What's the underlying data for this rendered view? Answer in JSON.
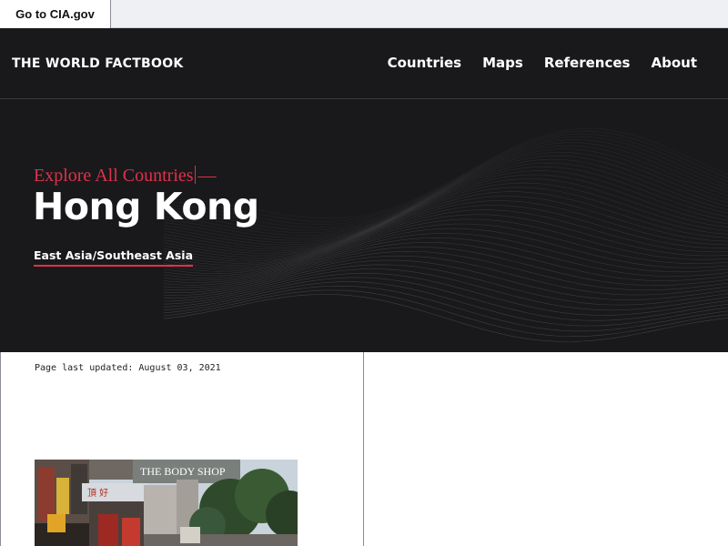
{
  "utility": {
    "cia_link": "Go to CIA.gov"
  },
  "header": {
    "brand": "THE WORLD FACTBOOK",
    "nav": [
      {
        "label": "Countries"
      },
      {
        "label": "Maps"
      },
      {
        "label": "References"
      },
      {
        "label": "About"
      }
    ]
  },
  "hero": {
    "explore_label": "Explore All Countries",
    "explore_suffix": "—",
    "country": "Hong Kong",
    "region": "East Asia/Southeast Asia"
  },
  "content": {
    "last_updated": "Page last updated: August 03, 2021",
    "photo_sign": "THE BODY SHOP"
  },
  "colors": {
    "accent": "#e0314b",
    "header_bg": "#19191b",
    "utility_bg": "#eef0f4"
  }
}
